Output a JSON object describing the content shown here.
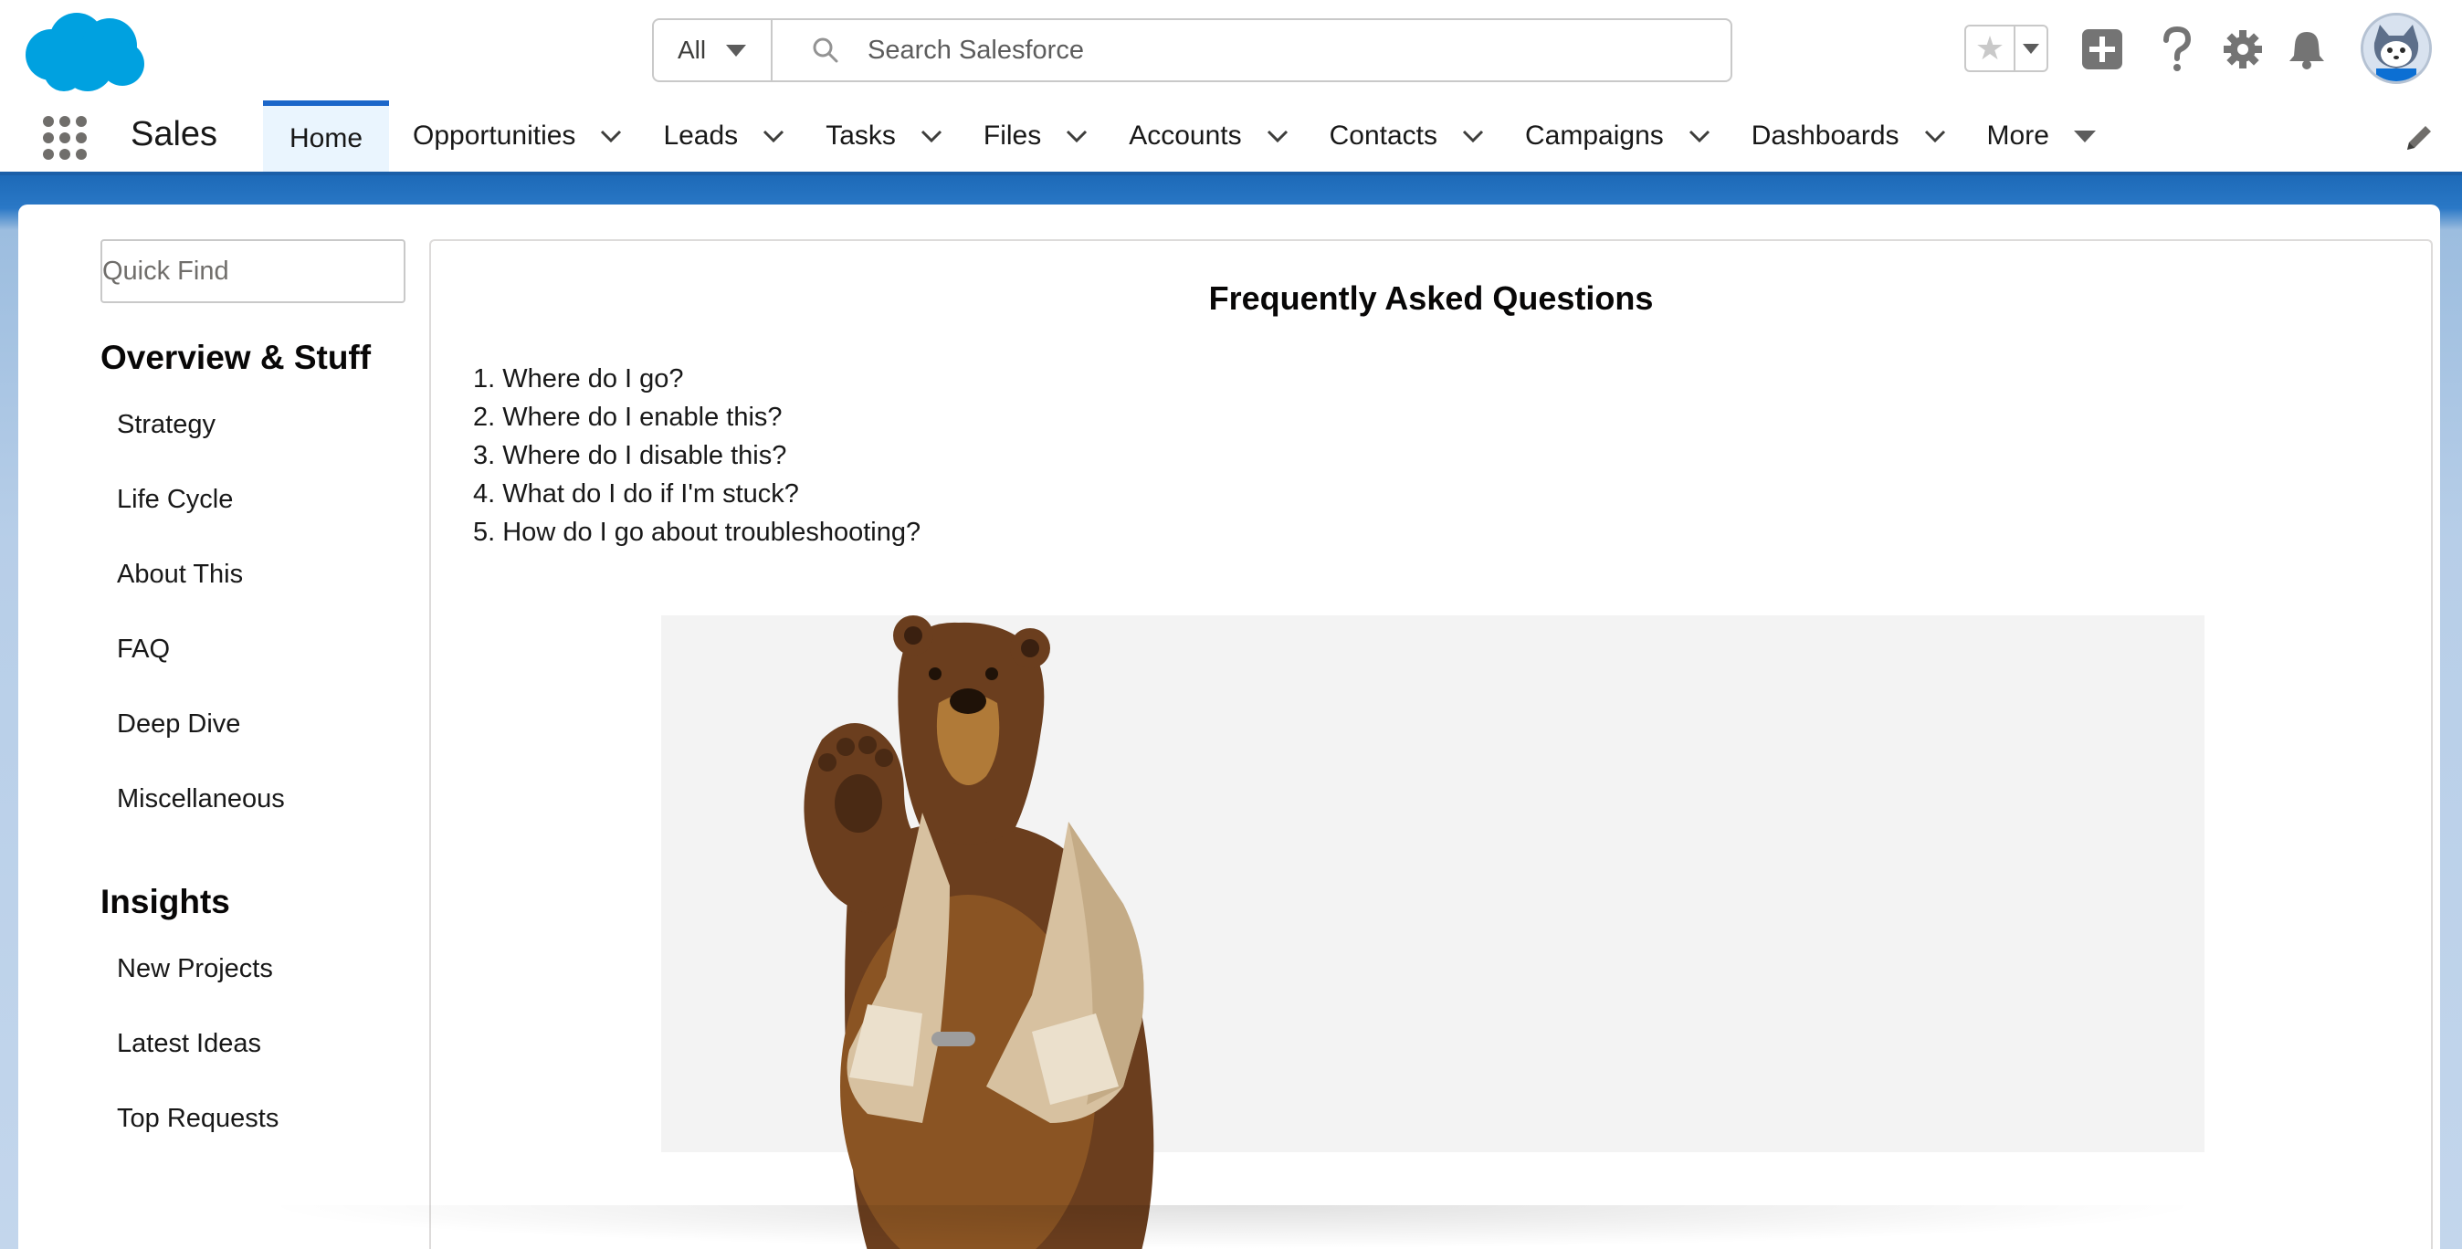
{
  "header": {
    "search": {
      "scope_label": "All",
      "placeholder": "Search Salesforce"
    },
    "icons": [
      "star-icon",
      "add-icon",
      "help-icon",
      "settings-gear-icon",
      "notification-bell-icon",
      "user-avatar"
    ]
  },
  "nav": {
    "app_name": "Sales",
    "items": [
      {
        "label": "Home",
        "active": true
      },
      {
        "label": "Opportunities"
      },
      {
        "label": "Leads"
      },
      {
        "label": "Tasks"
      },
      {
        "label": "Files"
      },
      {
        "label": "Accounts"
      },
      {
        "label": "Contacts"
      },
      {
        "label": "Campaigns"
      },
      {
        "label": "Dashboards"
      },
      {
        "label": "More"
      }
    ]
  },
  "sidebar": {
    "quick_find_placeholder": "Quick Find",
    "sections": [
      {
        "title": "Overview & Stuff",
        "items": [
          "Strategy",
          "Life Cycle",
          "About This",
          "FAQ",
          "Deep Dive",
          "Miscellaneous"
        ]
      },
      {
        "title": "Insights",
        "items": [
          "New Projects",
          "Latest Ideas",
          "Top Requests"
        ]
      }
    ]
  },
  "content": {
    "title": "Frequently Asked Questions",
    "questions": [
      "1. Where do I go?",
      "2. Where do I enable this?",
      "3. Where do I disable this?",
      "4. What do I do if I'm stuck?",
      "5. How do I go about troubleshooting?"
    ]
  },
  "colors": {
    "brand_blue": "#00a1e0",
    "nav_active_bg": "#eaf5fe",
    "nav_active_border": "#1b66c9",
    "band_blue": "#1d6ab8"
  }
}
